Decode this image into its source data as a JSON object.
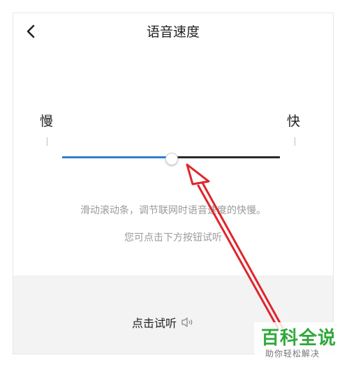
{
  "header": {
    "title": "语音速度"
  },
  "slider": {
    "slow_label": "慢",
    "fast_label": "快",
    "level_fraction": 0.5,
    "filled_color": "#2f7fd0",
    "rest_color": "#2a2a2a"
  },
  "description": {
    "line1": "滑动滚动条，调节联网时语音速度的快慢。",
    "line2": "您可点击下方按钮试听"
  },
  "try_listen": {
    "label": "点击试听",
    "icon": "speaker-icon"
  },
  "annotation": {
    "arrow_color": "#e0252b"
  },
  "watermark": {
    "main": "百科全说",
    "sub": "助你轻松解决",
    "color": "#2fa83a"
  },
  "icons": {
    "back": "chevron-left-icon"
  }
}
